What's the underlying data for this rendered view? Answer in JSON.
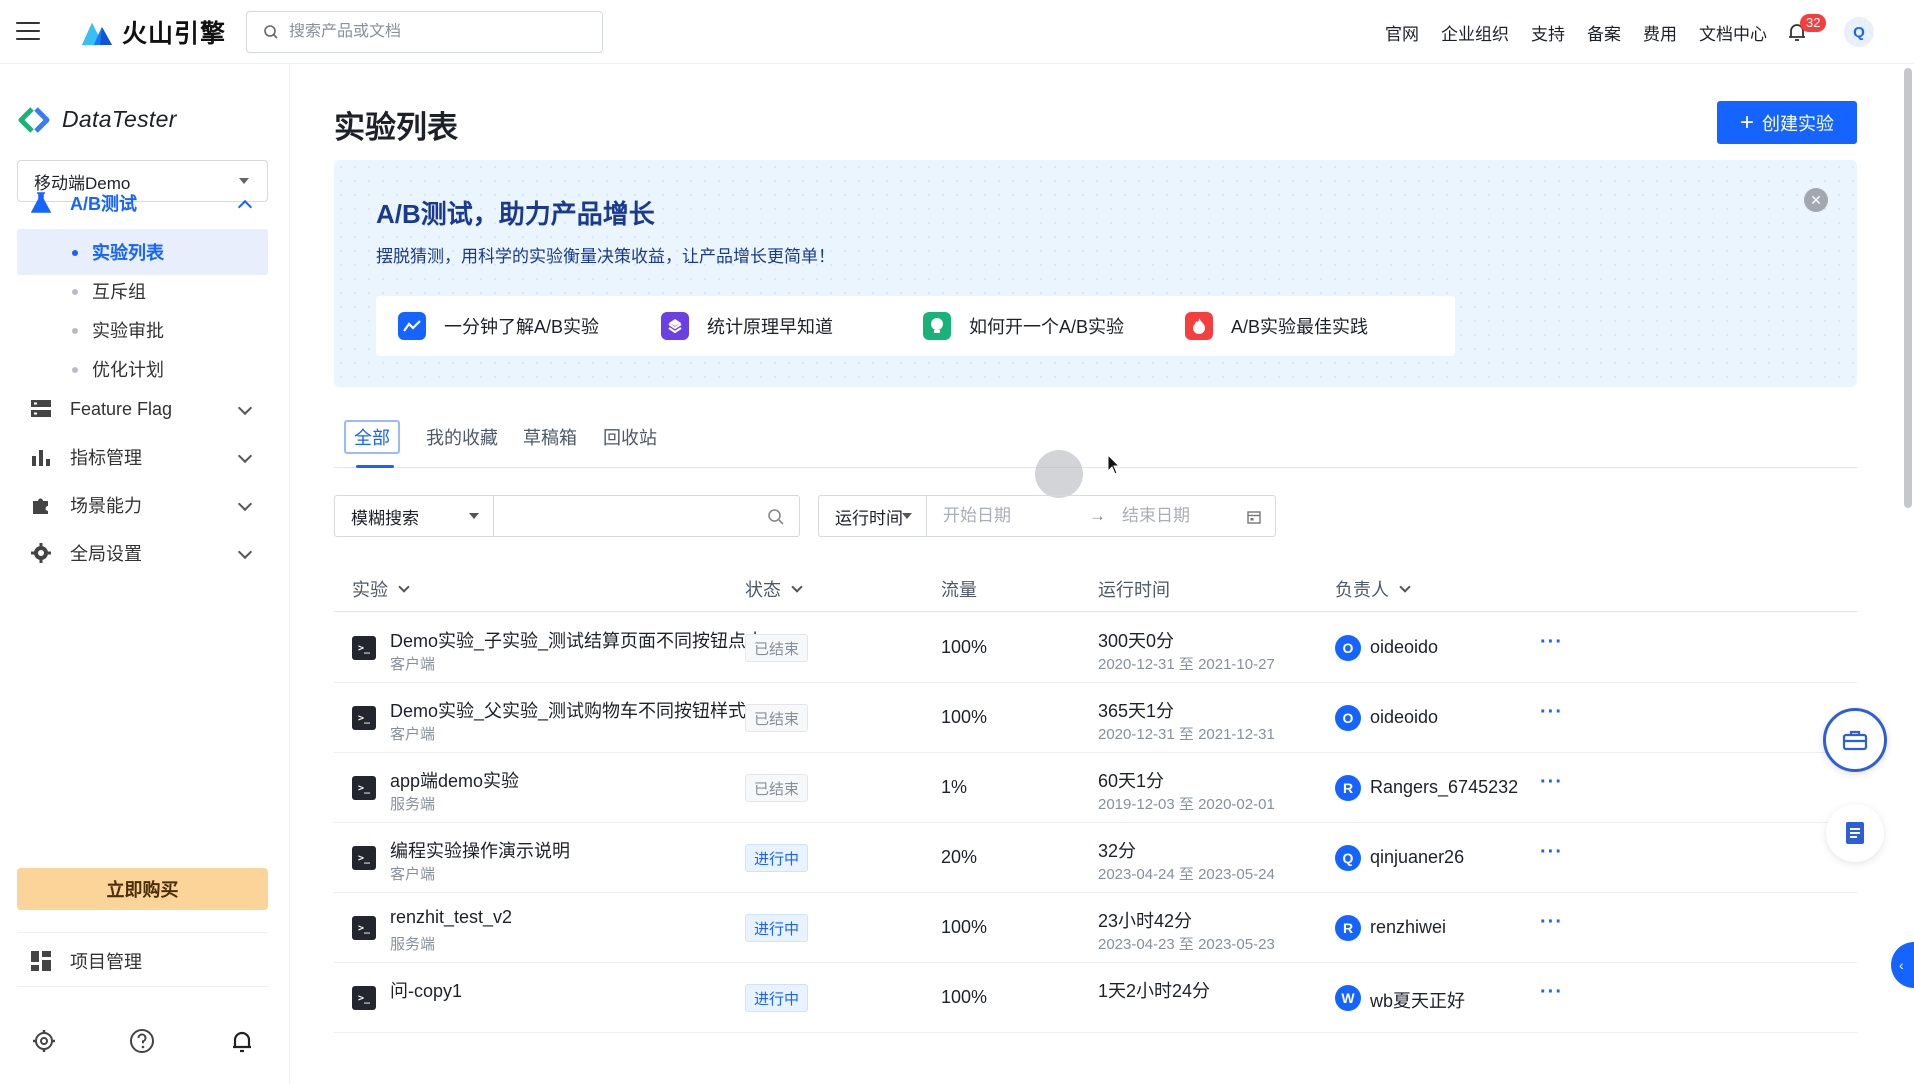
{
  "topbar": {
    "brand": "火山引擎",
    "search_placeholder": "搜索产品或文档",
    "nav": [
      "官网",
      "企业组织",
      "支持",
      "备案",
      "费用",
      "文档中心"
    ],
    "notification_count": "32",
    "user_initial": "Q"
  },
  "sidebar": {
    "product_name": "DataTester",
    "project": "移动端Demo",
    "ab_test": "A/B测试",
    "sub_items": [
      "实验列表",
      "互斥组",
      "实验审批",
      "优化计划"
    ],
    "menu": [
      "Feature Flag",
      "指标管理",
      "场景能力",
      "全局设置"
    ],
    "buy_label": "立即购买",
    "project_mgmt": "项目管理"
  },
  "main": {
    "title": "实验列表",
    "create_label": "创建实验",
    "banner": {
      "title": "A/B测试，助力产品增长",
      "subtitle": "摆脱猜测，用科学的实验衡量决策收益，让产品增长更简单！",
      "cards": [
        "一分钟了解A/B实验",
        "统计原理早知道",
        "如何开一个A/B实验",
        "A/B实验最佳实践"
      ]
    },
    "tabs": [
      "全部",
      "我的收藏",
      "草稿箱",
      "回收站"
    ],
    "filters": {
      "search_mode": "模糊搜索",
      "time_mode": "运行时间",
      "start_placeholder": "开始日期",
      "end_placeholder": "结束日期"
    },
    "columns": [
      "实验",
      "状态",
      "流量",
      "运行时间",
      "负责人"
    ],
    "rows": [
      {
        "name": "Demo实验_子实验_测试结算页面不同按钮点击",
        "type": "客户端",
        "status": "已结束",
        "traffic": "100%",
        "duration": "300天0分",
        "range": "2020-12-31 至 2021-10-27",
        "owner_initial": "O",
        "owner": "oideoido"
      },
      {
        "name": "Demo实验_父实验_测试购物车不同按钮样式...",
        "type": "客户端",
        "status": "已结束",
        "traffic": "100%",
        "duration": "365天1分",
        "range": "2020-12-31 至 2021-12-31",
        "owner_initial": "O",
        "owner": "oideoido"
      },
      {
        "name": "app端demo实验",
        "type": "服务端",
        "status": "已结束",
        "traffic": "1%",
        "duration": "60天1分",
        "range": "2019-12-03 至 2020-02-01",
        "owner_initial": "R",
        "owner": "Rangers_6745232"
      },
      {
        "name": "编程实验操作演示说明",
        "type": "客户端",
        "status": "进行中",
        "traffic": "20%",
        "duration": "32分",
        "range": "2023-04-24 至 2023-05-24",
        "owner_initial": "Q",
        "owner": "qinjuaner26"
      },
      {
        "name": "renzhit_test_v2",
        "type": "服务端",
        "status": "进行中",
        "traffic": "100%",
        "duration": "23小时42分",
        "range": "2023-04-23 至 2023-05-23",
        "owner_initial": "R",
        "owner": "renzhiwei"
      },
      {
        "name": "问-copy1",
        "type": "",
        "status": "进行中",
        "traffic": "100%",
        "duration": "1天2小时24分",
        "range": "",
        "owner_initial": "W",
        "owner": "wb夏天正好"
      }
    ],
    "more_glyph": "···"
  }
}
